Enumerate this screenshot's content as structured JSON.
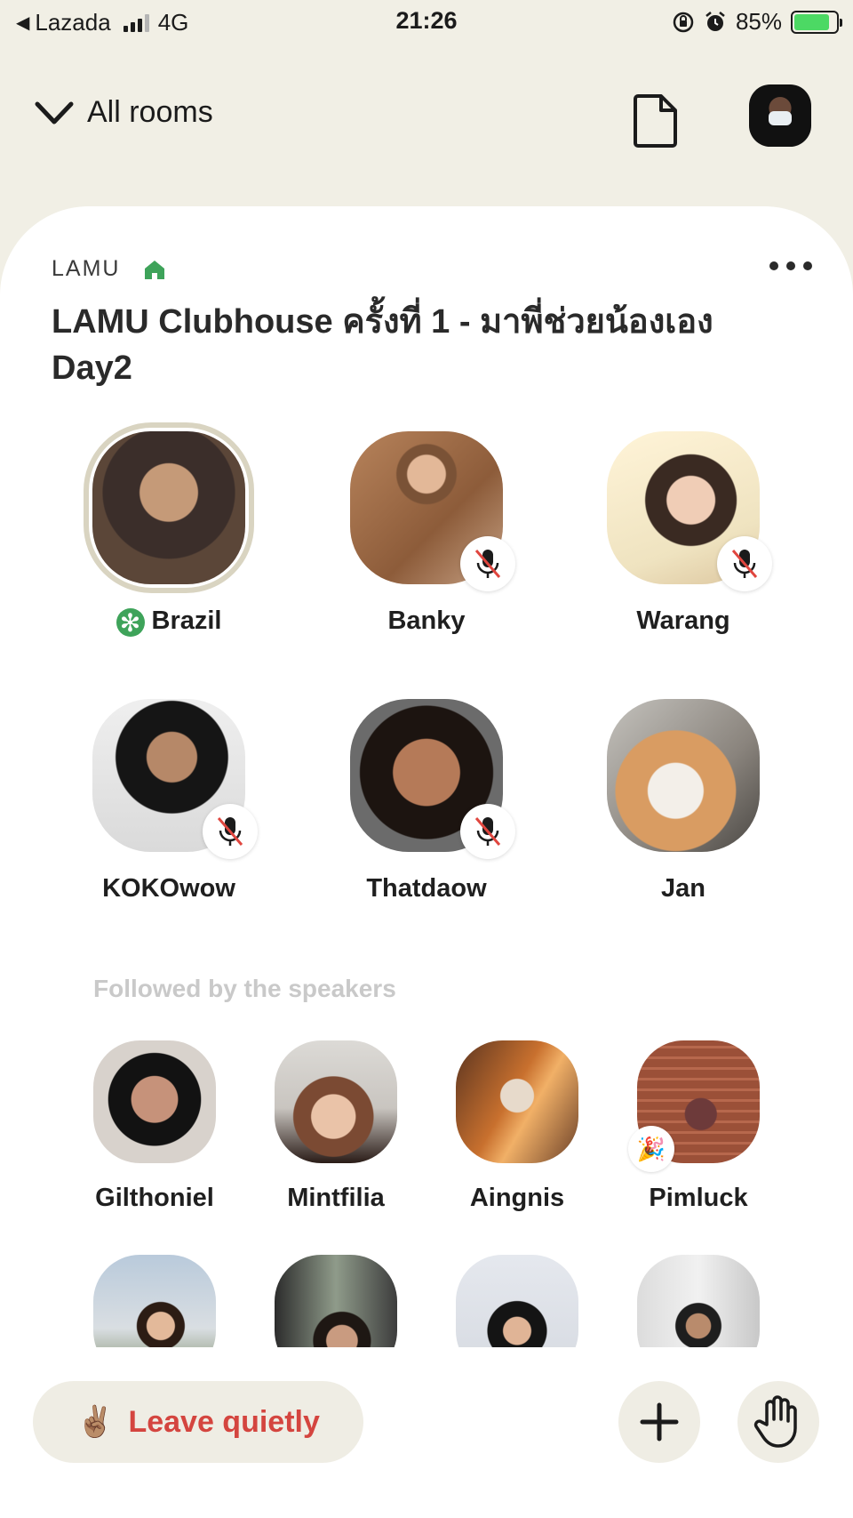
{
  "status_bar": {
    "carrier": "Lazada",
    "network": "4G",
    "time": "21:26",
    "battery": "85%",
    "battery_level": 0.85
  },
  "header": {
    "rooms_label": "All rooms",
    "icons": [
      "chevron-down-icon",
      "document-icon",
      "profile-avatar"
    ]
  },
  "room": {
    "club_name": "LAMU",
    "title": "LAMU Clubhouse ครั้งที่ 1 - มาพี่ช่วยน้องเอง Day2",
    "speakers": [
      {
        "name": "Brazil",
        "moderator": true,
        "muted": false,
        "speaking": true
      },
      {
        "name": "Banky",
        "moderator": false,
        "muted": true
      },
      {
        "name": "Warang",
        "moderator": false,
        "muted": true
      },
      {
        "name": "KOKOwow",
        "moderator": false,
        "muted": true
      },
      {
        "name": "Thatdaow",
        "moderator": false,
        "muted": true
      },
      {
        "name": "Jan",
        "moderator": false,
        "muted": false
      }
    ],
    "followed_label": "Followed by the speakers",
    "listeners": [
      {
        "name": "Gilthoniel"
      },
      {
        "name": "Mintfilia"
      },
      {
        "name": "Aingnis"
      },
      {
        "name": "Pimluck",
        "new_user": true
      }
    ]
  },
  "bottom_bar": {
    "leave_label": "Leave quietly",
    "leave_emoji": "✌🏽"
  },
  "colors": {
    "background": "#f1efe5",
    "panel": "#ffffff",
    "leave_text": "#d4453f",
    "moderator_green": "#3ea35a",
    "club_house_green": "#3ea35a"
  }
}
